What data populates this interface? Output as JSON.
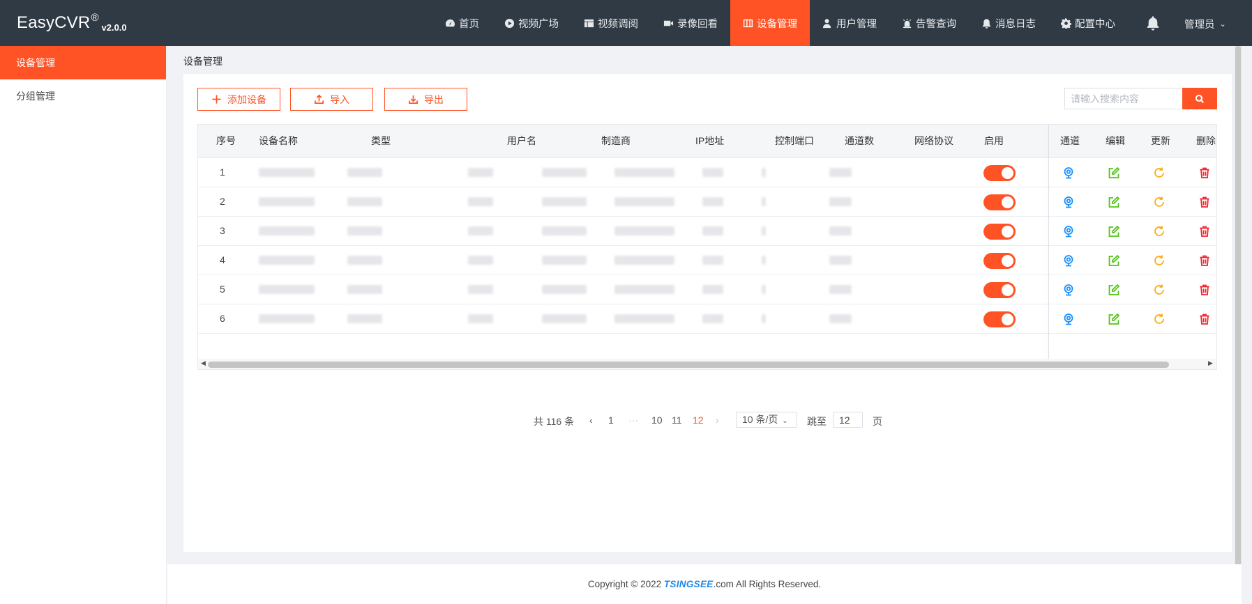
{
  "app": {
    "name": "EasyCVR",
    "reg": "®",
    "version": "v2.0.0"
  },
  "nav": {
    "items": [
      {
        "label": "首页",
        "icon": "dashboard-icon"
      },
      {
        "label": "视频广场",
        "icon": "play-circle-icon"
      },
      {
        "label": "视频调阅",
        "icon": "layout-grid-icon"
      },
      {
        "label": "录像回看",
        "icon": "video-camera-icon"
      },
      {
        "label": "设备管理",
        "icon": "columns-icon",
        "active": true
      },
      {
        "label": "用户管理",
        "icon": "user-icon"
      },
      {
        "label": "告警查询",
        "icon": "siren-icon"
      },
      {
        "label": "消息日志",
        "icon": "bell-icon"
      },
      {
        "label": "配置中心",
        "icon": "gear-icon"
      }
    ],
    "user": "管理员"
  },
  "sidebar": {
    "items": [
      {
        "label": "设备管理",
        "active": true
      },
      {
        "label": "分组管理"
      }
    ]
  },
  "breadcrumb": "设备管理",
  "toolbar": {
    "add_label": "添加设备",
    "import_label": "导入",
    "export_label": "导出",
    "search_placeholder": "请输入搜索内容"
  },
  "table": {
    "headers": {
      "index": "序号",
      "name": "设备名称",
      "type": "类型",
      "username": "用户名",
      "maker": "制造商",
      "ip": "IP地址",
      "port": "控制端口",
      "channels": "通道数",
      "protocol": "网络协议",
      "enabled": "启用",
      "channel_action": "通道",
      "edit_action": "编辑",
      "update_action": "更新",
      "delete_action": "删除"
    },
    "rows": [
      {
        "index": "1",
        "enabled": true
      },
      {
        "index": "2",
        "enabled": true
      },
      {
        "index": "3",
        "enabled": true
      },
      {
        "index": "4",
        "enabled": true
      },
      {
        "index": "5",
        "enabled": true
      },
      {
        "index": "6",
        "enabled": true
      }
    ]
  },
  "pagination": {
    "total": "共 116 条",
    "pages": [
      "1",
      "···",
      "10",
      "11",
      "12"
    ],
    "current": "12",
    "page_size": "10 条/页",
    "jump_label": "跳至",
    "jump_value": "12",
    "page_suffix": "页"
  },
  "footer": {
    "prefix": "Copyright © 2022 ",
    "logo": "TSINGSEE",
    "suffix": ".com All Rights Reserved."
  },
  "colors": {
    "accent": "#ff5325",
    "topbar": "#2f3a45",
    "channel_icon": "#1890ff",
    "edit_icon": "#52c41a",
    "update_icon": "#faad14",
    "delete_icon": "#f5222d"
  }
}
